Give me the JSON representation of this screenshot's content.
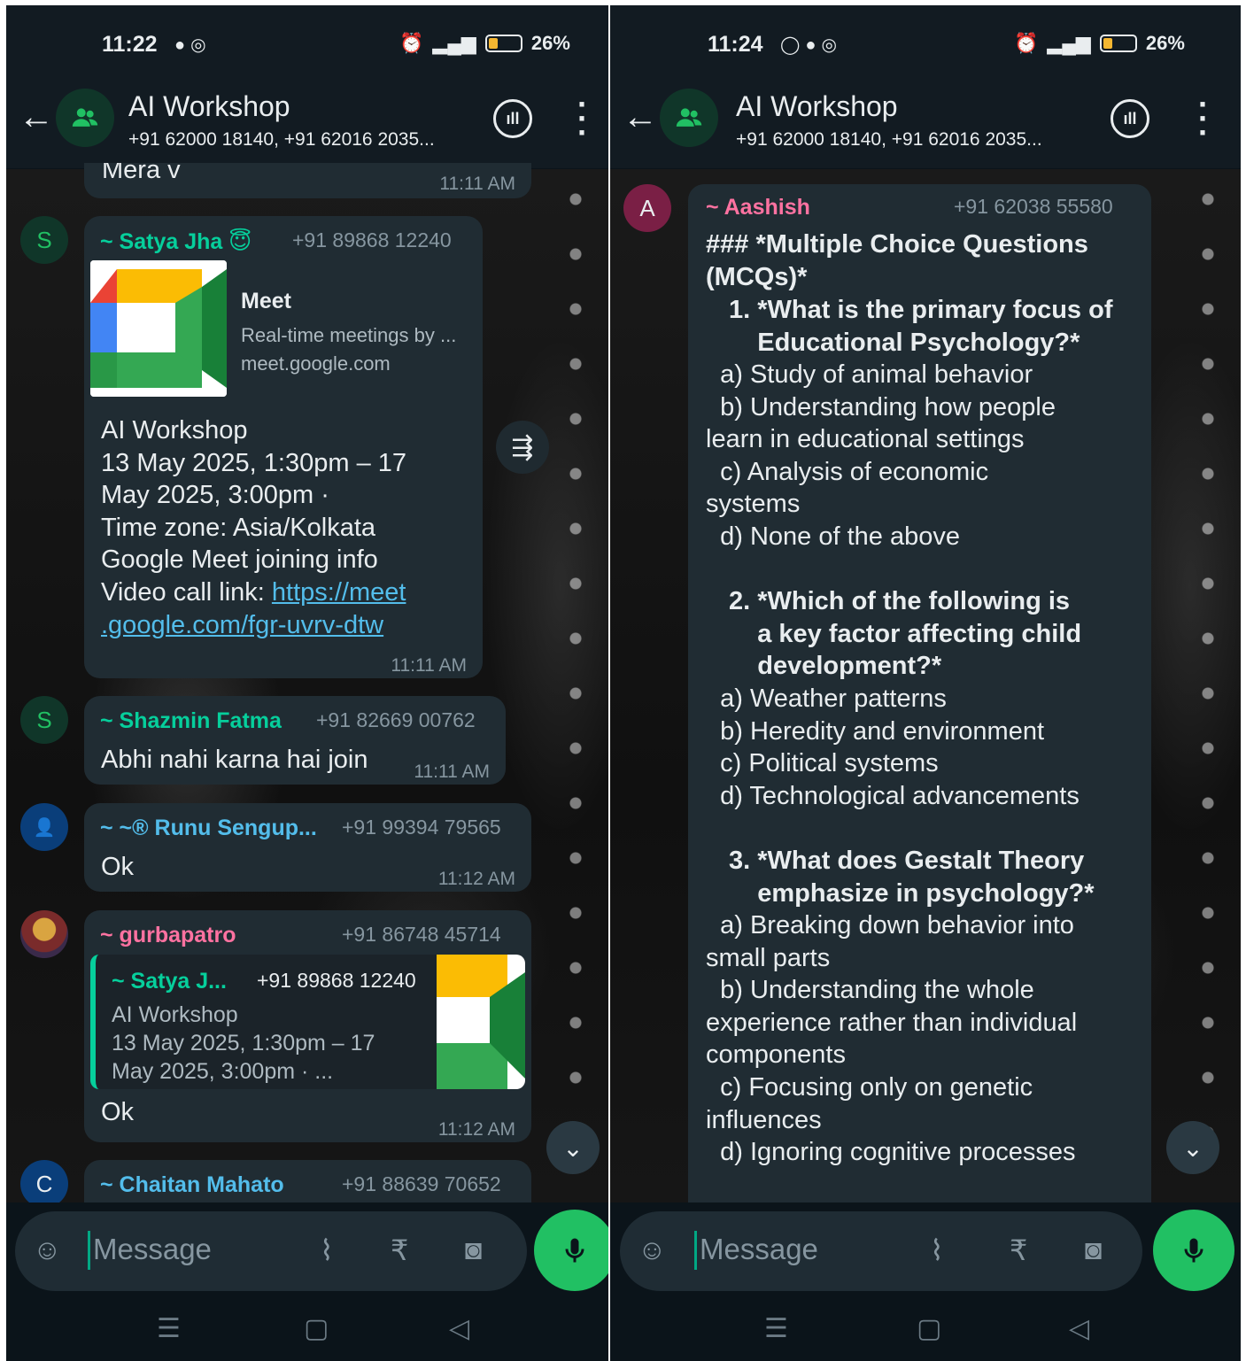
{
  "status_left": {
    "time": "11:22",
    "battery": "26%"
  },
  "status_right": {
    "time": "11:24",
    "battery": "26%"
  },
  "header": {
    "title": "AI Workshop",
    "subtitle": "+91 62000 18140, +91 62016 2035..."
  },
  "left": {
    "partial_msg": {
      "text": "Mera v",
      "time": "11:11 AM"
    },
    "msg1": {
      "sender": "~ Satya Jha 😇",
      "phone": "+91 89868 12240",
      "preview_title": "Meet",
      "preview_desc": "Real-time meetings by ...",
      "preview_domain": "meet.google.com",
      "body": "AI Workshop\n13 May 2025, 1:30pm – 17\nMay 2025, 3:00pm ·\nTime zone: Asia/Kolkata\nGoogle Meet joining info\nVideo call link: ",
      "link_part1": "https://meet",
      "link_part2": ".google.com/fgr-uvrv-dtw",
      "time": "11:11 AM",
      "avatar": "S"
    },
    "msg2": {
      "sender": "~ Shazmin Fatma",
      "phone": "+91 82669 00762",
      "text": "Abhi nahi karna hai join",
      "time": "11:11 AM",
      "avatar": "S"
    },
    "msg3": {
      "sender": "~ ~® Runu Sengup...",
      "phone": "+91 99394 79565",
      "text": "Ok",
      "time": "11:12 AM"
    },
    "msg4": {
      "sender": "~ gurbapatro",
      "phone": "+91 86748 45714",
      "quote_sender": "~ Satya J...",
      "quote_phone": "+91 89868 12240",
      "quote_text": "AI Workshop\n13 May 2025, 1:30pm – 17\nMay 2025, 3:00pm · ...",
      "text": "Ok",
      "time": "11:12 AM"
    },
    "msg5": {
      "sender": "~ Chaitan Mahato",
      "phone": "+91 88639 70652",
      "avatar": "C"
    }
  },
  "right": {
    "msg": {
      "sender": "~ Aashish",
      "phone": "+91 62038 55580",
      "avatar": "A",
      "heading": "### *Multiple Choice Questions\n(MCQs)*",
      "q1": "1. *What is the primary focus of\n    Educational Psychology?*",
      "q1_opts": "  a) Study of animal behavior\n  b) Understanding how people\nlearn in educational settings\n  c) Analysis of economic\nsystems\n  d) None of the above",
      "q2": "2. *Which of the following is\n    a key factor affecting child\n    development?*",
      "q2_opts": "  a) Weather patterns\n  b) Heredity and environment\n  c) Political systems\n  d) Technological advancements",
      "q3": "3. *What does Gestalt Theory\n    emphasize in psychology?*",
      "q3_opts": "  a) Breaking down behavior into\nsmall parts\n  b) Understanding the whole\nexperience rather than individual\ncomponents\n  c) Focusing only on genetic\ninfluences\n  d) Ignoring cognitive processes"
    }
  },
  "composer": {
    "placeholder": "Message"
  },
  "colors": {
    "accent_green": "#21c063",
    "sender_green": "#06cf9c",
    "sender_blue": "#53bdeb",
    "sender_pink": "#ff72a1",
    "bubble": "#202c33",
    "background": "#0b141a"
  },
  "icons": [
    "back-arrow-icon",
    "group-avatar-icon",
    "voice-chat-icon",
    "more-vert-icon",
    "forward-icon",
    "scroll-down-icon",
    "sticker-icon",
    "attach-icon",
    "rupee-icon",
    "camera-icon",
    "mic-icon",
    "menu-nav-icon",
    "home-nav-icon",
    "back-nav-icon"
  ]
}
